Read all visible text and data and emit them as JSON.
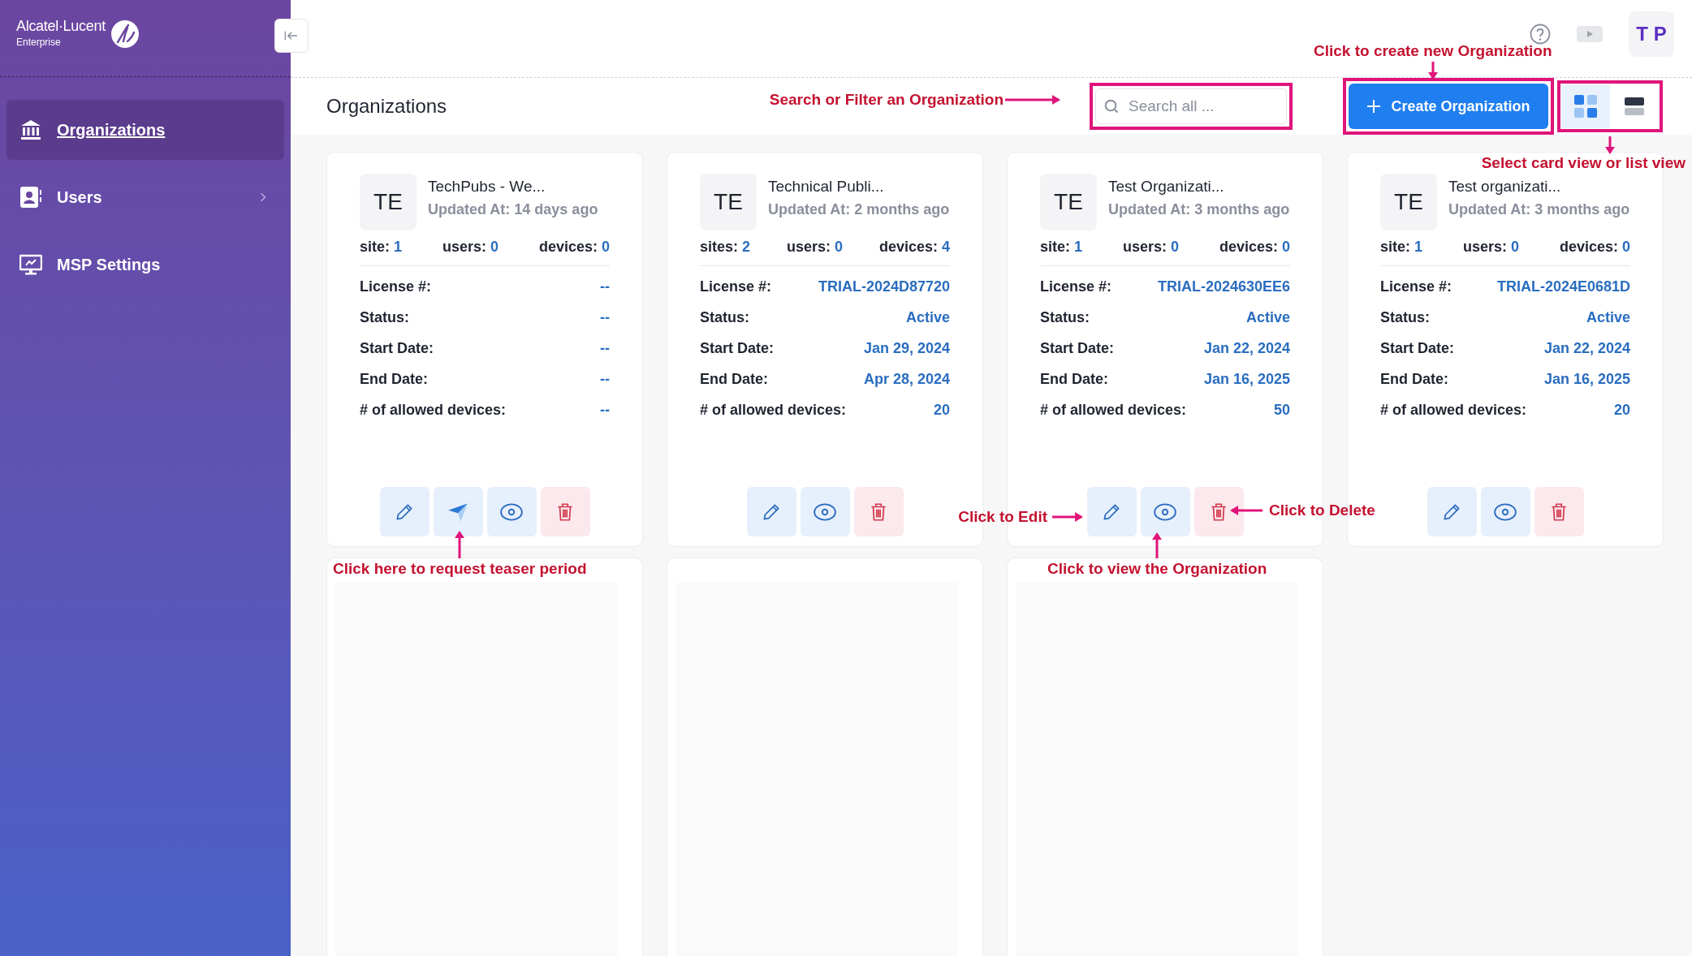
{
  "sidebar": {
    "logo": {
      "brand": "Alcatel·Lucent",
      "sub": "Enterprise"
    },
    "items": [
      {
        "label": "Organizations",
        "selected": true,
        "has_submenu": false
      },
      {
        "label": "Users",
        "selected": false,
        "has_submenu": true
      },
      {
        "label": "MSP Settings",
        "selected": false,
        "has_submenu": false
      }
    ]
  },
  "header": {
    "avatar": "T P"
  },
  "toolbar": {
    "title": "Organizations",
    "search": {
      "placeholder": "Search all ...",
      "highlighted": true
    },
    "create_button": {
      "label": "Create Organization",
      "highlighted": true
    },
    "views": {
      "highlighted": true,
      "options": [
        {
          "kind": "grid",
          "selected": true
        },
        {
          "kind": "list",
          "selected": false
        }
      ]
    }
  },
  "cards": [
    {
      "kind": "org",
      "initials": "TE",
      "name": "TechPubs - We...",
      "updated": "Updated At: 14 days ago",
      "stats": [
        {
          "label": "site:",
          "value": "1"
        },
        {
          "label": "users:",
          "value": "0"
        },
        {
          "label": "devices:",
          "value": "0"
        }
      ],
      "fields": [
        {
          "label": "License #:",
          "value": "--"
        },
        {
          "label": "Status:",
          "value": "--"
        },
        {
          "label": "Start Date:",
          "value": "--"
        },
        {
          "label": "End Date:",
          "value": "--"
        },
        {
          "label": "# of allowed devices:",
          "value": "--"
        }
      ],
      "actions": [
        {
          "kind": "edit"
        },
        {
          "kind": "send"
        },
        {
          "kind": "view"
        },
        {
          "kind": "delete"
        }
      ]
    },
    {
      "kind": "org",
      "initials": "TE",
      "name": "Technical Publi...",
      "updated": "Updated At: 2 months ago",
      "stats": [
        {
          "label": "sites:",
          "value": "2"
        },
        {
          "label": "users:",
          "value": "0"
        },
        {
          "label": "devices:",
          "value": "4"
        }
      ],
      "fields": [
        {
          "label": "License #:",
          "value": "TRIAL-2024D87720"
        },
        {
          "label": "Status:",
          "value": "Active"
        },
        {
          "label": "Start Date:",
          "value": "Jan 29, 2024"
        },
        {
          "label": "End Date:",
          "value": "Apr 28, 2024"
        },
        {
          "label": "# of allowed devices:",
          "value": "20"
        }
      ],
      "actions": [
        {
          "kind": "edit"
        },
        {
          "kind": "view"
        },
        {
          "kind": "delete"
        }
      ]
    },
    {
      "kind": "org",
      "initials": "TE",
      "name": "Test Organizati...",
      "updated": "Updated At: 3 months ago",
      "stats": [
        {
          "label": "site:",
          "value": "1"
        },
        {
          "label": "users:",
          "value": "0"
        },
        {
          "label": "devices:",
          "value": "0"
        }
      ],
      "fields": [
        {
          "label": "License #:",
          "value": "TRIAL-2024630EE6"
        },
        {
          "label": "Status:",
          "value": "Active"
        },
        {
          "label": "Start Date:",
          "value": "Jan 22, 2024"
        },
        {
          "label": "End Date:",
          "value": "Jan 16, 2025"
        },
        {
          "label": "# of allowed devices:",
          "value": "50"
        }
      ],
      "actions": [
        {
          "kind": "edit"
        },
        {
          "kind": "view"
        },
        {
          "kind": "delete"
        }
      ]
    },
    {
      "kind": "org",
      "initials": "TE",
      "name": "Test organizati...",
      "updated": "Updated At: 3 months ago",
      "stats": [
        {
          "label": "site:",
          "value": "1"
        },
        {
          "label": "users:",
          "value": "0"
        },
        {
          "label": "devices:",
          "value": "0"
        }
      ],
      "fields": [
        {
          "label": "License #:",
          "value": "TRIAL-2024E0681D"
        },
        {
          "label": "Status:",
          "value": "Active"
        },
        {
          "label": "Start Date:",
          "value": "Jan 22, 2024"
        },
        {
          "label": "End Date:",
          "value": "Jan 16, 2025"
        },
        {
          "label": "# of allowed devices:",
          "value": "20"
        }
      ],
      "actions": [
        {
          "kind": "edit"
        },
        {
          "kind": "view"
        },
        {
          "kind": "delete"
        }
      ]
    },
    {
      "kind": "loading"
    },
    {
      "kind": "loading"
    },
    {
      "kind": "loading"
    }
  ],
  "annotations": [
    {
      "text": "Click to create new Organization"
    },
    {
      "text": "Search or Filter an Organization"
    },
    {
      "text": "Select card view or list view"
    },
    {
      "text": "Click here to request teaser period"
    },
    {
      "text": "Click to Edit"
    },
    {
      "text": "Click to Delete"
    },
    {
      "text": "Click to view the Organization"
    }
  ]
}
